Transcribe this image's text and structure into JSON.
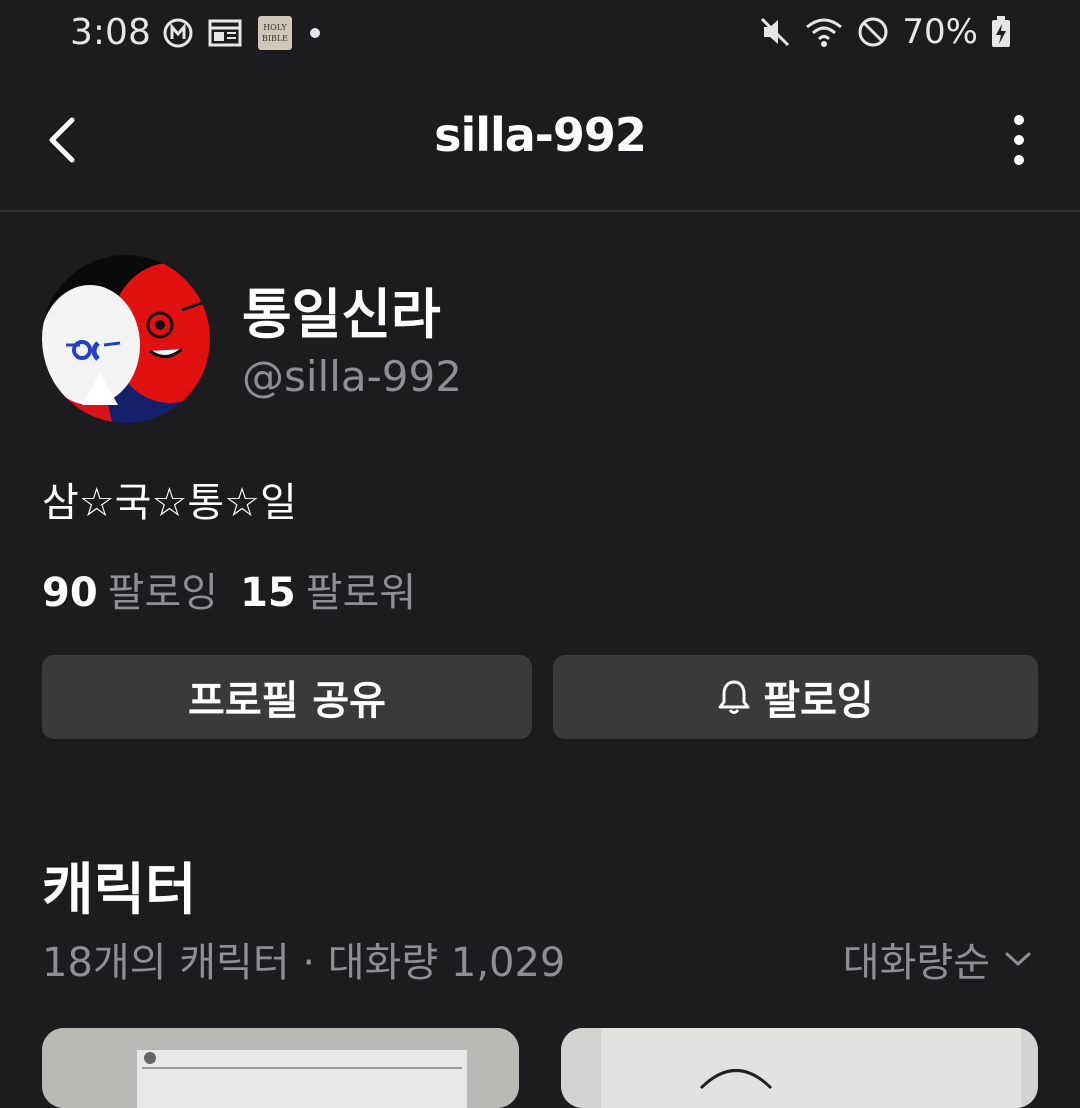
{
  "status_bar": {
    "time": "3:08",
    "left_icons": [
      "m-circle-icon",
      "news-icon",
      "holy-bible-icon",
      "dot-icon"
    ],
    "bible_icon_text": [
      "HOLY",
      "BIBLE"
    ],
    "right_icons": [
      "mute-icon",
      "wifi-icon",
      "dnd-icon",
      "battery-charging-icon"
    ],
    "battery": "70%"
  },
  "header": {
    "title": "silla-992"
  },
  "profile": {
    "display_name": "통일신라",
    "handle": "@silla-992",
    "bio": "삼☆국☆통☆일",
    "following_count": "90",
    "following_label": "팔로잉",
    "followers_count": "15",
    "followers_label": "팔로워"
  },
  "actions": {
    "share_label": "프로필 공유",
    "follow_label": "팔로잉"
  },
  "characters": {
    "title": "캐릭터",
    "summary": "18개의 캐릭터 · 대화량 1,029",
    "sort_label": "대화량순"
  },
  "colors": {
    "background": "#1c1c1e",
    "button": "#3a3a3c",
    "muted_text": "#8e8e93"
  }
}
